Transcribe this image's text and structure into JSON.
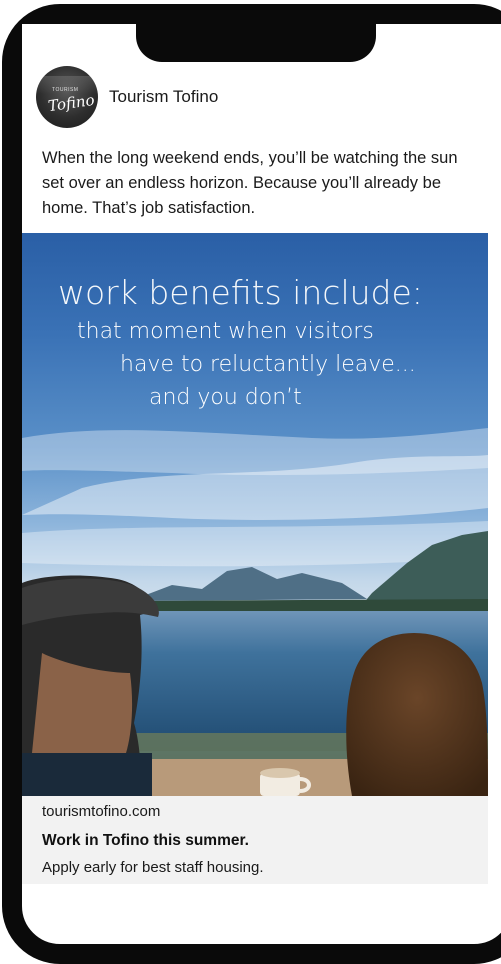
{
  "post": {
    "account_name": "Tourism Tofino",
    "avatar_logo": {
      "small_text": "TOURISM",
      "script_text": "Tofino"
    },
    "caption": "When the long weekend ends, you’ll be watching the sun set over an endless horizon. Because you’ll already be home. That’s job satisfaction."
  },
  "ad": {
    "overlay_heading": "work benefits include:",
    "overlay_line1": "that moment when visitors",
    "overlay_line2": "have to reluctantly leave...",
    "overlay_line3": "and you don’t"
  },
  "link_card": {
    "domain": "tourismtofino.com",
    "headline": "Work in Tofino this summer.",
    "description": "Apply early for best staff housing."
  },
  "colors": {
    "frame": "#0a0a0a",
    "sky_top": "#2a5fa6",
    "water": "#2c5f8c",
    "footer_bg": "#f2f2f2"
  }
}
